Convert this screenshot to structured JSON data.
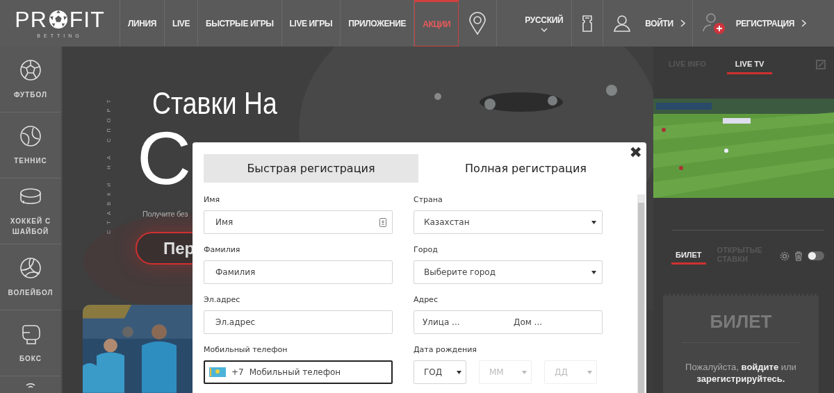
{
  "header": {
    "logo": {
      "text_left": "PR",
      "text_right": "FIT",
      "tagline": "BETTING"
    },
    "nav": [
      {
        "label": "ЛИНИЯ",
        "selected": false
      },
      {
        "label": "LIVE",
        "selected": false
      },
      {
        "label": "БЫСТРЫЕ ИГРЫ",
        "selected": false
      },
      {
        "label": "LIVE ИГРЫ",
        "selected": false
      },
      {
        "label": "ПРИЛОЖЕНИЕ",
        "selected": false
      },
      {
        "label": "АКЦИИ",
        "selected": true
      }
    ],
    "language": "РУССКИЙ",
    "login": "ВОЙТИ",
    "register": "РЕГИСТРАЦИЯ"
  },
  "sidebar": {
    "items": [
      {
        "label": "ФУТБОЛ"
      },
      {
        "label": "ТЕННИС"
      },
      {
        "label": "ХОККЕЙ С ШАЙБОЙ"
      },
      {
        "label": "ВОЛЕЙБОЛ"
      },
      {
        "label": "БОКС"
      }
    ]
  },
  "hero": {
    "side_text": "СТАВКИ НА СПОРТ",
    "title": "Ставки На",
    "big_title": "С",
    "subtitle": "Получите без",
    "button": "Пер"
  },
  "right_panel": {
    "tabs": [
      {
        "label": "LIVE INFO",
        "selected": false
      },
      {
        "label": "LIVE TV",
        "selected": true
      }
    ],
    "bet_tabs": [
      {
        "label": "БИЛЕТ",
        "selected": true
      },
      {
        "label": "ОТКРЫТЫЕ СТАВКИ",
        "selected": false
      }
    ],
    "auto_accept_on": false,
    "ticket": {
      "title": "БИЛЕТ",
      "message": "Пожалуйста, **войдите** или **зарегистрируйтесь.**"
    }
  },
  "modal": {
    "close": "✖",
    "tabs": [
      {
        "label": "Быстрая регистрация",
        "selected": false
      },
      {
        "label": "Полная регистрация",
        "selected": true
      }
    ],
    "left_fields": [
      {
        "kind": "contact",
        "label": "Имя",
        "placeholder": "Имя",
        "focused": false
      },
      {
        "kind": "text",
        "label": "Фамилия",
        "placeholder": "Фамилия",
        "focused": false
      },
      {
        "kind": "text",
        "label": "Эл.адрес",
        "placeholder": "Эл.адрес",
        "focused": false
      },
      {
        "kind": "phone",
        "label": "Мобильный телефон",
        "prefix": "+7",
        "placeholder": "Мобильный телефон",
        "focused": true
      }
    ],
    "right_fields": [
      {
        "kind": "select",
        "label": "Страна",
        "value": "Казахстан"
      },
      {
        "kind": "select",
        "label": "Город",
        "value": "Выберите город"
      },
      {
        "kind": "address",
        "label": "Адрес",
        "placeholders": [
          "Улица ...",
          "Дом ..."
        ]
      },
      {
        "kind": "date",
        "label": "Дата рождения",
        "parts": [
          {
            "value": "ГОД",
            "disabled": false
          },
          {
            "value": "ММ",
            "disabled": true
          },
          {
            "value": "ДД",
            "disabled": true
          }
        ]
      }
    ]
  }
}
